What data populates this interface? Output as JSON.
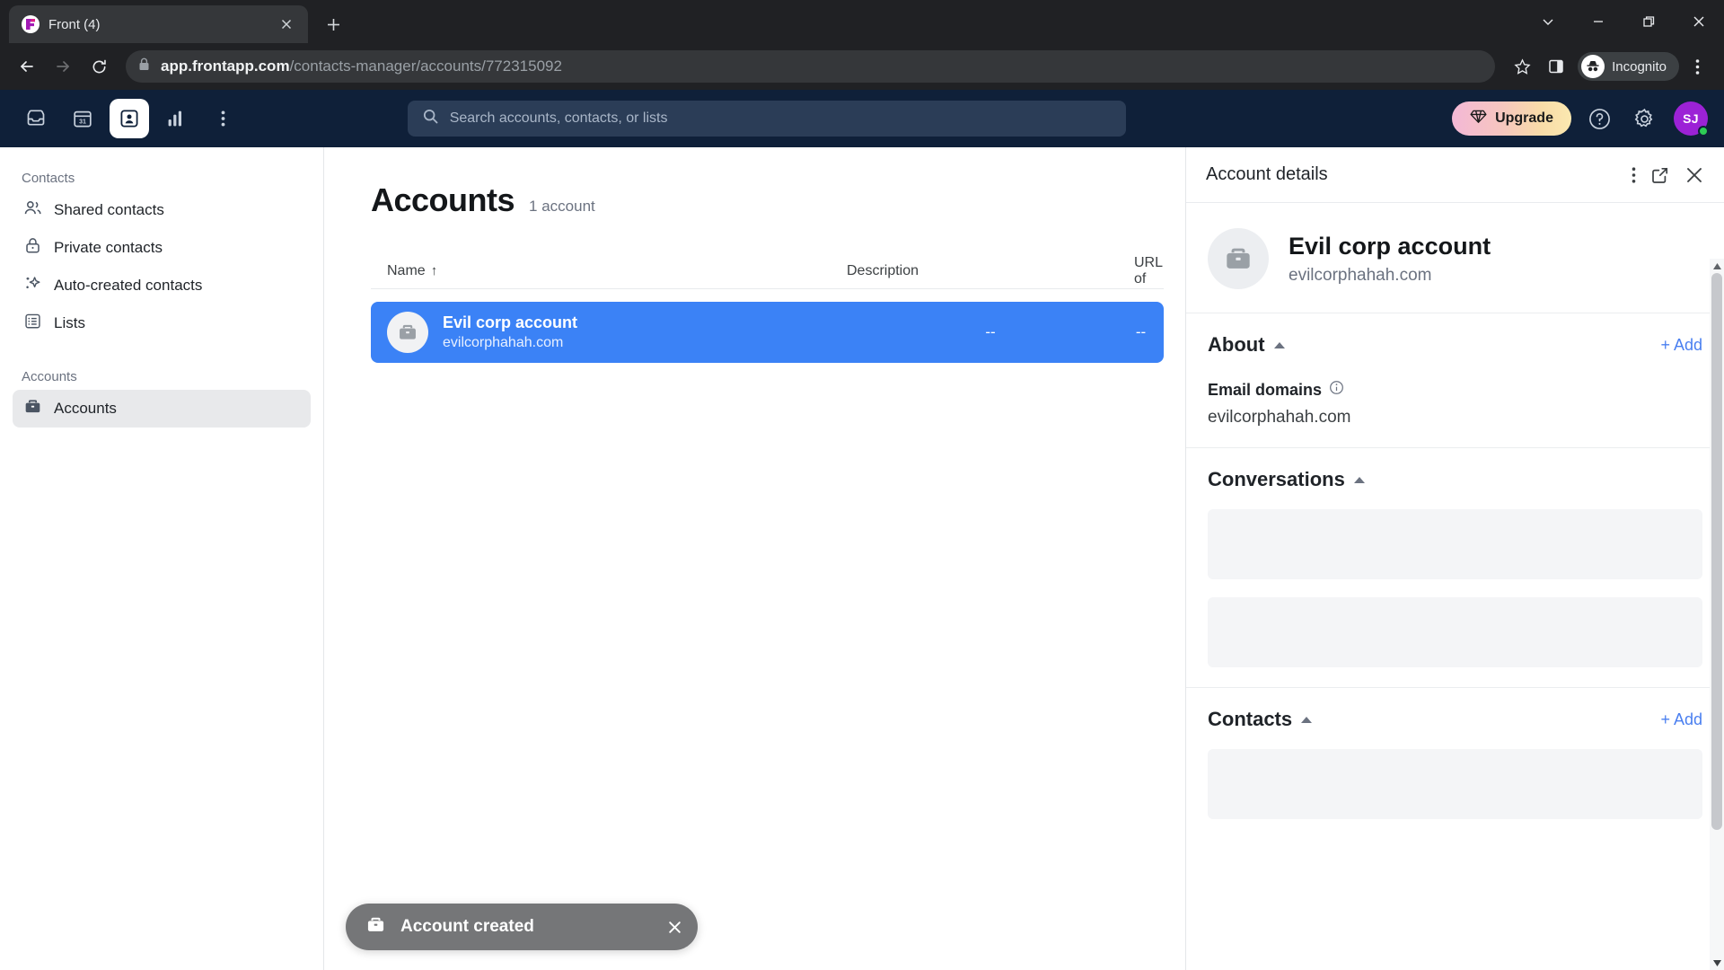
{
  "browser": {
    "tab": {
      "title": "Front (4)",
      "favicon": "front-logo-icon",
      "close_icon": "close-icon"
    },
    "new_tab_label": "+",
    "window_controls": [
      "tab-search-icon",
      "minimize-icon",
      "maximize-icon",
      "close-window-icon"
    ],
    "nav": {
      "back": "back-arrow-icon",
      "forward": "forward-arrow-icon",
      "reload": "reload-icon"
    },
    "address": {
      "lock_icon": "lock-icon",
      "domain": "app.frontapp.com",
      "path": "/contacts-manager/accounts/772315092",
      "full_url": "app.frontapp.com/contacts-manager/accounts/772315092"
    },
    "bookmark_icon": "star-icon",
    "side_panel_icon": "side-panel-icon",
    "profile": {
      "label": "Incognito",
      "icon": "incognito-hat-icon"
    },
    "menu_icon": "chrome-menu-icon"
  },
  "app": {
    "nav_items": [
      {
        "name": "inbox",
        "icon": "inbox-icon",
        "active": false
      },
      {
        "name": "calendar",
        "icon": "calendar-31-icon",
        "active": false
      },
      {
        "name": "contacts",
        "icon": "contact-card-icon",
        "active": true
      },
      {
        "name": "analytics",
        "icon": "bar-chart-icon",
        "active": false
      },
      {
        "name": "more",
        "icon": "more-vertical-icon",
        "active": false
      }
    ],
    "search": {
      "placeholder": "Search accounts, contacts, or lists",
      "icon": "search-icon"
    },
    "upgrade": {
      "label": "Upgrade",
      "icon": "diamond-icon"
    },
    "help_icon": "help-circle-icon",
    "settings_icon": "gear-icon",
    "user": {
      "initials": "SJ",
      "status": "online",
      "avatar_color": "#9c22d6",
      "status_color": "#2ecc55"
    }
  },
  "sidebar": {
    "groups": [
      {
        "label": "Contacts",
        "items": [
          {
            "label": "Shared contacts",
            "icon": "people-icon",
            "active": false
          },
          {
            "label": "Private contacts",
            "icon": "lock-icon",
            "active": false
          },
          {
            "label": "Auto-created contacts",
            "icon": "sparkle-icon",
            "active": false
          },
          {
            "label": "Lists",
            "icon": "list-icon",
            "active": false
          }
        ]
      },
      {
        "label": "Accounts",
        "items": [
          {
            "label": "Accounts",
            "icon": "briefcase-icon",
            "active": true
          }
        ]
      }
    ]
  },
  "main": {
    "title": "Accounts",
    "count_label": "1 account",
    "columns": [
      {
        "label": "Name",
        "sort": "asc",
        "sort_glyph": "↑"
      },
      {
        "label": "Description"
      },
      {
        "label": "URL of"
      }
    ],
    "rows": [
      {
        "name": "Evil corp account",
        "domain": "evilcorphahah.com",
        "description": "--",
        "url": "--",
        "selected": true,
        "avatar_icon": "briefcase-icon"
      }
    ],
    "selected_row_color": "#3b82f6"
  },
  "detail": {
    "title": "Account details",
    "actions": [
      "more-vertical-icon",
      "open-external-icon",
      "close-icon"
    ],
    "account": {
      "name": "Evil corp account",
      "domain": "evilcorphahah.com",
      "avatar_icon": "briefcase-icon"
    },
    "sections": [
      {
        "title": "About",
        "collapsed": false,
        "add_label": "+ Add",
        "fields": [
          {
            "label": "Email domains",
            "info_icon": "info-icon",
            "value": "evilcorphahah.com"
          }
        ]
      },
      {
        "title": "Conversations",
        "collapsed": false,
        "placeholders": 2
      },
      {
        "title": "Contacts",
        "collapsed": false,
        "add_label": "+ Add",
        "placeholders": 1
      }
    ],
    "accent_color": "#4a7ff0"
  },
  "toast": {
    "message": "Account created",
    "icon": "briefcase-icon",
    "close_icon": "close-icon",
    "background": "#757678"
  }
}
